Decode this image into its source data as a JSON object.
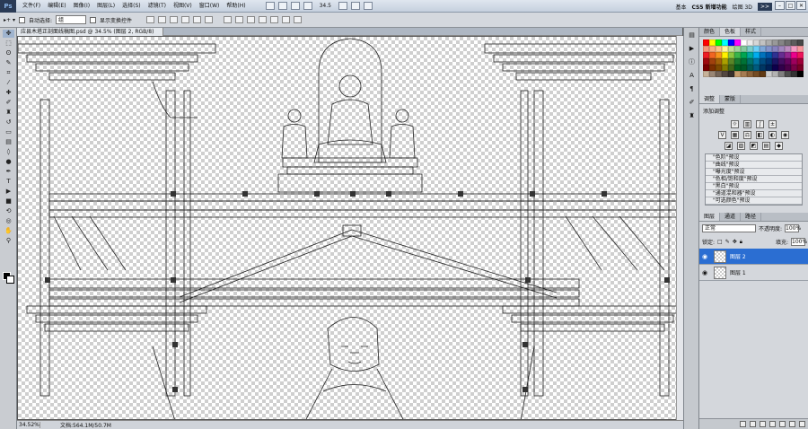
{
  "app": {
    "logo": "Ps",
    "menu": [
      "文件(F)",
      "编辑(E)",
      "图像(I)",
      "图层(L)",
      "选择(S)",
      "滤镜(T)",
      "视图(V)",
      "窗口(W)",
      "帮助(H)"
    ],
    "zoom_readout": "34.5",
    "workspace": [
      "基本",
      "CS5 新增功能",
      "绘图 3D"
    ],
    "chevron": ">>"
  },
  "options": {
    "auto_select_label": "自动选择:",
    "auto_select_value": "组",
    "show_transform_label": "显示变换控件"
  },
  "document": {
    "tab_title": "应县木塔正剖面线稿图.psd @ 34.5% (图层 2, RGB/8)",
    "status_zoom": "34.52%",
    "status_file": "文档:564.1M/50.7M"
  },
  "swatch_panel": {
    "tabs": [
      "颜色",
      "色板",
      "样式"
    ],
    "colors": [
      "#ff0000",
      "#ffff00",
      "#00ff00",
      "#00ffff",
      "#0000ff",
      "#ff00ff",
      "#ffffff",
      "#ebebeb",
      "#d6d6d6",
      "#c2c2c2",
      "#adadad",
      "#999999",
      "#858585",
      "#707070",
      "#5c5c5c",
      "#474747",
      "#f7977a",
      "#f9ad81",
      "#fdc68a",
      "#fff79a",
      "#c4df9b",
      "#a2d39c",
      "#82ca9d",
      "#7bcdc8",
      "#6ecff6",
      "#7ea7d8",
      "#8493ca",
      "#8882be",
      "#a187be",
      "#bc8dbf",
      "#f49ac2",
      "#f6989d",
      "#ed1c24",
      "#f26522",
      "#f7941d",
      "#fff200",
      "#8dc73f",
      "#39b54a",
      "#00a651",
      "#00a99d",
      "#00aeef",
      "#0072bc",
      "#0054a6",
      "#2e3192",
      "#662d91",
      "#92278f",
      "#ec008c",
      "#ed145b",
      "#9e0b0f",
      "#a0410d",
      "#a36209",
      "#aba000",
      "#598527",
      "#1a7b30",
      "#007236",
      "#00746b",
      "#0076a3",
      "#004b80",
      "#003471",
      "#1b1464",
      "#440e62",
      "#630460",
      "#9e005d",
      "#9e0039",
      "#790000",
      "#7b2e00",
      "#7d4900",
      "#827b00",
      "#406618",
      "#005e20",
      "#005826",
      "#005952",
      "#005b7f",
      "#003663",
      "#002157",
      "#0d004c",
      "#32004b",
      "#4b0049",
      "#7b0046",
      "#7a0026",
      "#c7b299",
      "#998675",
      "#736357",
      "#534741",
      "#37302d",
      "#c69c6d",
      "#a67c52",
      "#8c6239",
      "#754c24",
      "#603913",
      "#cccccc",
      "#b3b3b3",
      "#808080",
      "#4d4d4d",
      "#333333",
      "#000000"
    ]
  },
  "adjustments": {
    "tabs": [
      "调整",
      "蒙版"
    ],
    "title": "添加调整",
    "presets": [
      "\"色阶\"预设",
      "\"曲线\"预设",
      "\"曝光度\"预设",
      "\"色相/饱和度\"预设",
      "\"黑白\"预设",
      "\"通道混和器\"预设",
      "\"可选颜色\"预设"
    ]
  },
  "layers": {
    "tabs": [
      "图层",
      "通道",
      "路径"
    ],
    "blend_mode": "正常",
    "opacity_label": "不透明度:",
    "opacity_value": "100%",
    "lock_label": "锁定:",
    "fill_label": "填充:",
    "fill_value": "100%",
    "items": [
      {
        "name": "图层 2",
        "selected": true
      },
      {
        "name": "图层 1",
        "selected": false
      }
    ]
  }
}
